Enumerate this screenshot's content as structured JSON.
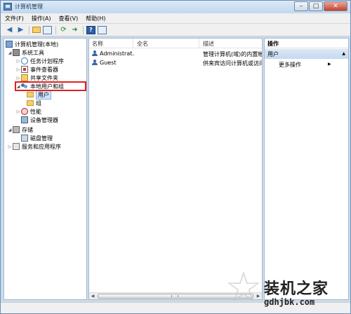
{
  "window": {
    "title": "计算机管理"
  },
  "menu": [
    "文件(F)",
    "操作(A)",
    "查看(V)",
    "帮助(H)"
  ],
  "tree": {
    "root": "计算机管理(本地)",
    "system_tools": "系统工具",
    "task_scheduler": "任务计划程序",
    "event_viewer": "事件查看器",
    "shared_folders": "共享文件夹",
    "local_users_groups": "本地用户和组",
    "users": "用户",
    "groups": "组",
    "performance": "性能",
    "device_manager": "设备管理器",
    "storage": "存储",
    "disk_management": "磁盘管理",
    "services_apps": "服务和应用程序"
  },
  "list": {
    "columns": [
      "名称",
      "全名",
      "描述"
    ],
    "rows": [
      {
        "name": "Administrat...",
        "fullname": "",
        "desc": "管理计算机(域)的内置帐户"
      },
      {
        "name": "Guest",
        "fullname": "",
        "desc": "供来宾访问计算机或访问域"
      }
    ]
  },
  "actions": {
    "title": "操作",
    "section": "用户",
    "item": "更多操作"
  },
  "watermark": {
    "title": "装机之家",
    "url": "gdhjbk.com"
  },
  "icons": {
    "back": "back-arrow-icon",
    "forward": "forward-arrow-icon",
    "help": "help-icon"
  }
}
